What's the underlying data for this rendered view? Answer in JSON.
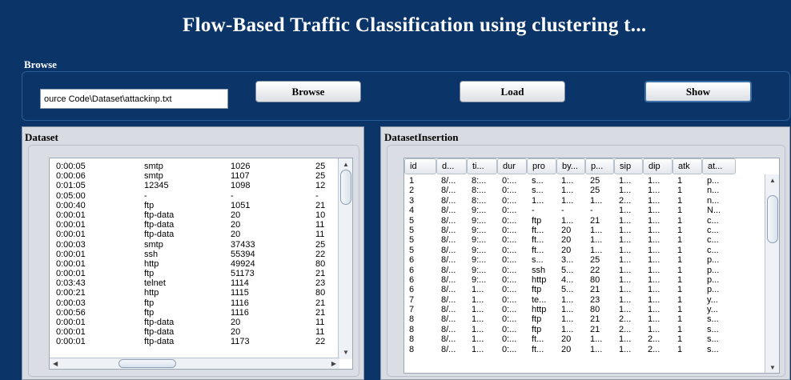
{
  "title": "Flow-Based Traffic Classification using clustering t...",
  "browse": {
    "section_label": "Browse",
    "path_value": "ource Code\\Dataset\\attackinp.txt",
    "browse_label": "Browse",
    "load_label": "Load",
    "show_label": "Show"
  },
  "dataset": {
    "section_label": "Dataset",
    "rows": [
      [
        "0:00:05",
        "smtp",
        "1026",
        "25"
      ],
      [
        "0:00:06",
        "smtp",
        "1107",
        "25"
      ],
      [
        "0:01:05",
        "12345",
        "1098",
        "12"
      ],
      [
        "0:05:00",
        "-",
        "-",
        "-"
      ],
      [
        "0:00:40",
        "ftp",
        "1051",
        "21"
      ],
      [
        "0:00:01",
        "ftp-data",
        "20",
        "10"
      ],
      [
        "0:00:01",
        "ftp-data",
        "20",
        "11"
      ],
      [
        "0:00:01",
        "ftp-data",
        "20",
        "11"
      ],
      [
        "0:00:03",
        "smtp",
        "37433",
        "25"
      ],
      [
        "0:00:01",
        "ssh",
        "55394",
        "22"
      ],
      [
        "0:00:01",
        "http",
        "49924",
        "80"
      ],
      [
        "0:00:01",
        "ftp",
        "51173",
        "21"
      ],
      [
        "0:03:43",
        "telnet",
        "1114",
        "23"
      ],
      [
        "0:00:21",
        "http",
        "1115",
        "80"
      ],
      [
        "0:00:03",
        "ftp",
        "1116",
        "21"
      ],
      [
        "0:00:56",
        "ftp",
        "1116",
        "21"
      ],
      [
        "0:00:01",
        "ftp-data",
        "20",
        "11"
      ],
      [
        "0:00:01",
        "ftp-data",
        "20",
        "11"
      ],
      [
        "0:00:01",
        "ftp-data",
        "1173",
        "22"
      ]
    ]
  },
  "insertion": {
    "section_label": "DatasetInsertion",
    "columns": [
      "id",
      "d...",
      "ti...",
      "dur",
      "pro",
      "by...",
      "p...",
      "sip",
      "dip",
      "atk",
      "at..."
    ],
    "rows": [
      [
        "1",
        "8/...",
        "8:...",
        "0:...",
        "s...",
        "1...",
        "25",
        "1...",
        "1...",
        "1",
        "p..."
      ],
      [
        "2",
        "8/...",
        "8:...",
        "0:...",
        "s...",
        "1...",
        "25",
        "1...",
        "1...",
        "1",
        "n..."
      ],
      [
        "3",
        "8/...",
        "8:...",
        "0:...",
        "1...",
        "1...",
        "1...",
        "2...",
        "1...",
        "1",
        "n..."
      ],
      [
        "4",
        "8/...",
        "9:...",
        "0:...",
        "-",
        "-",
        "-",
        "1...",
        "1...",
        "1",
        "N..."
      ],
      [
        "5",
        "8/...",
        "9:...",
        "0:...",
        "ftp",
        "1...",
        "21",
        "1...",
        "1...",
        "1",
        "c..."
      ],
      [
        "5",
        "8/...",
        "9:...",
        "0:...",
        "ft...",
        "20",
        "1...",
        "1...",
        "1...",
        "1",
        "c..."
      ],
      [
        "5",
        "8/...",
        "9:...",
        "0:...",
        "ft...",
        "20",
        "1...",
        "1...",
        "1...",
        "1",
        "c..."
      ],
      [
        "5",
        "8/...",
        "9:...",
        "0:...",
        "ft...",
        "20",
        "1...",
        "1...",
        "1...",
        "1",
        "c..."
      ],
      [
        "6",
        "8/...",
        "9:...",
        "0:...",
        "s...",
        "3...",
        "25",
        "1...",
        "1...",
        "1",
        "p..."
      ],
      [
        "6",
        "8/...",
        "9:...",
        "0:...",
        "ssh",
        "5...",
        "22",
        "1...",
        "1...",
        "1",
        "p..."
      ],
      [
        "6",
        "8/...",
        "9:...",
        "0:...",
        "http",
        "4...",
        "80",
        "1...",
        "1...",
        "1",
        "p..."
      ],
      [
        "6",
        "8/...",
        "1...",
        "0:...",
        "ftp",
        "5...",
        "21",
        "1...",
        "1...",
        "1",
        "p..."
      ],
      [
        "7",
        "8/...",
        "1...",
        "0:...",
        "te...",
        "1...",
        "23",
        "1...",
        "1...",
        "1",
        "y..."
      ],
      [
        "7",
        "8/...",
        "1...",
        "0:...",
        "http",
        "1...",
        "80",
        "1...",
        "1...",
        "1",
        "y..."
      ],
      [
        "8",
        "8/...",
        "1...",
        "0:...",
        "ftp",
        "1...",
        "21",
        "2...",
        "1...",
        "1",
        "s..."
      ],
      [
        "8",
        "8/...",
        "1...",
        "0:...",
        "ftp",
        "1...",
        "21",
        "2...",
        "1...",
        "1",
        "s..."
      ],
      [
        "8",
        "8/...",
        "1...",
        "0:...",
        "ft...",
        "20",
        "1...",
        "1...",
        "2...",
        "1",
        "s..."
      ],
      [
        "8",
        "8/...",
        "1...",
        "0:...",
        "ft...",
        "20",
        "1...",
        "1...",
        "2...",
        "1",
        "s..."
      ]
    ]
  }
}
